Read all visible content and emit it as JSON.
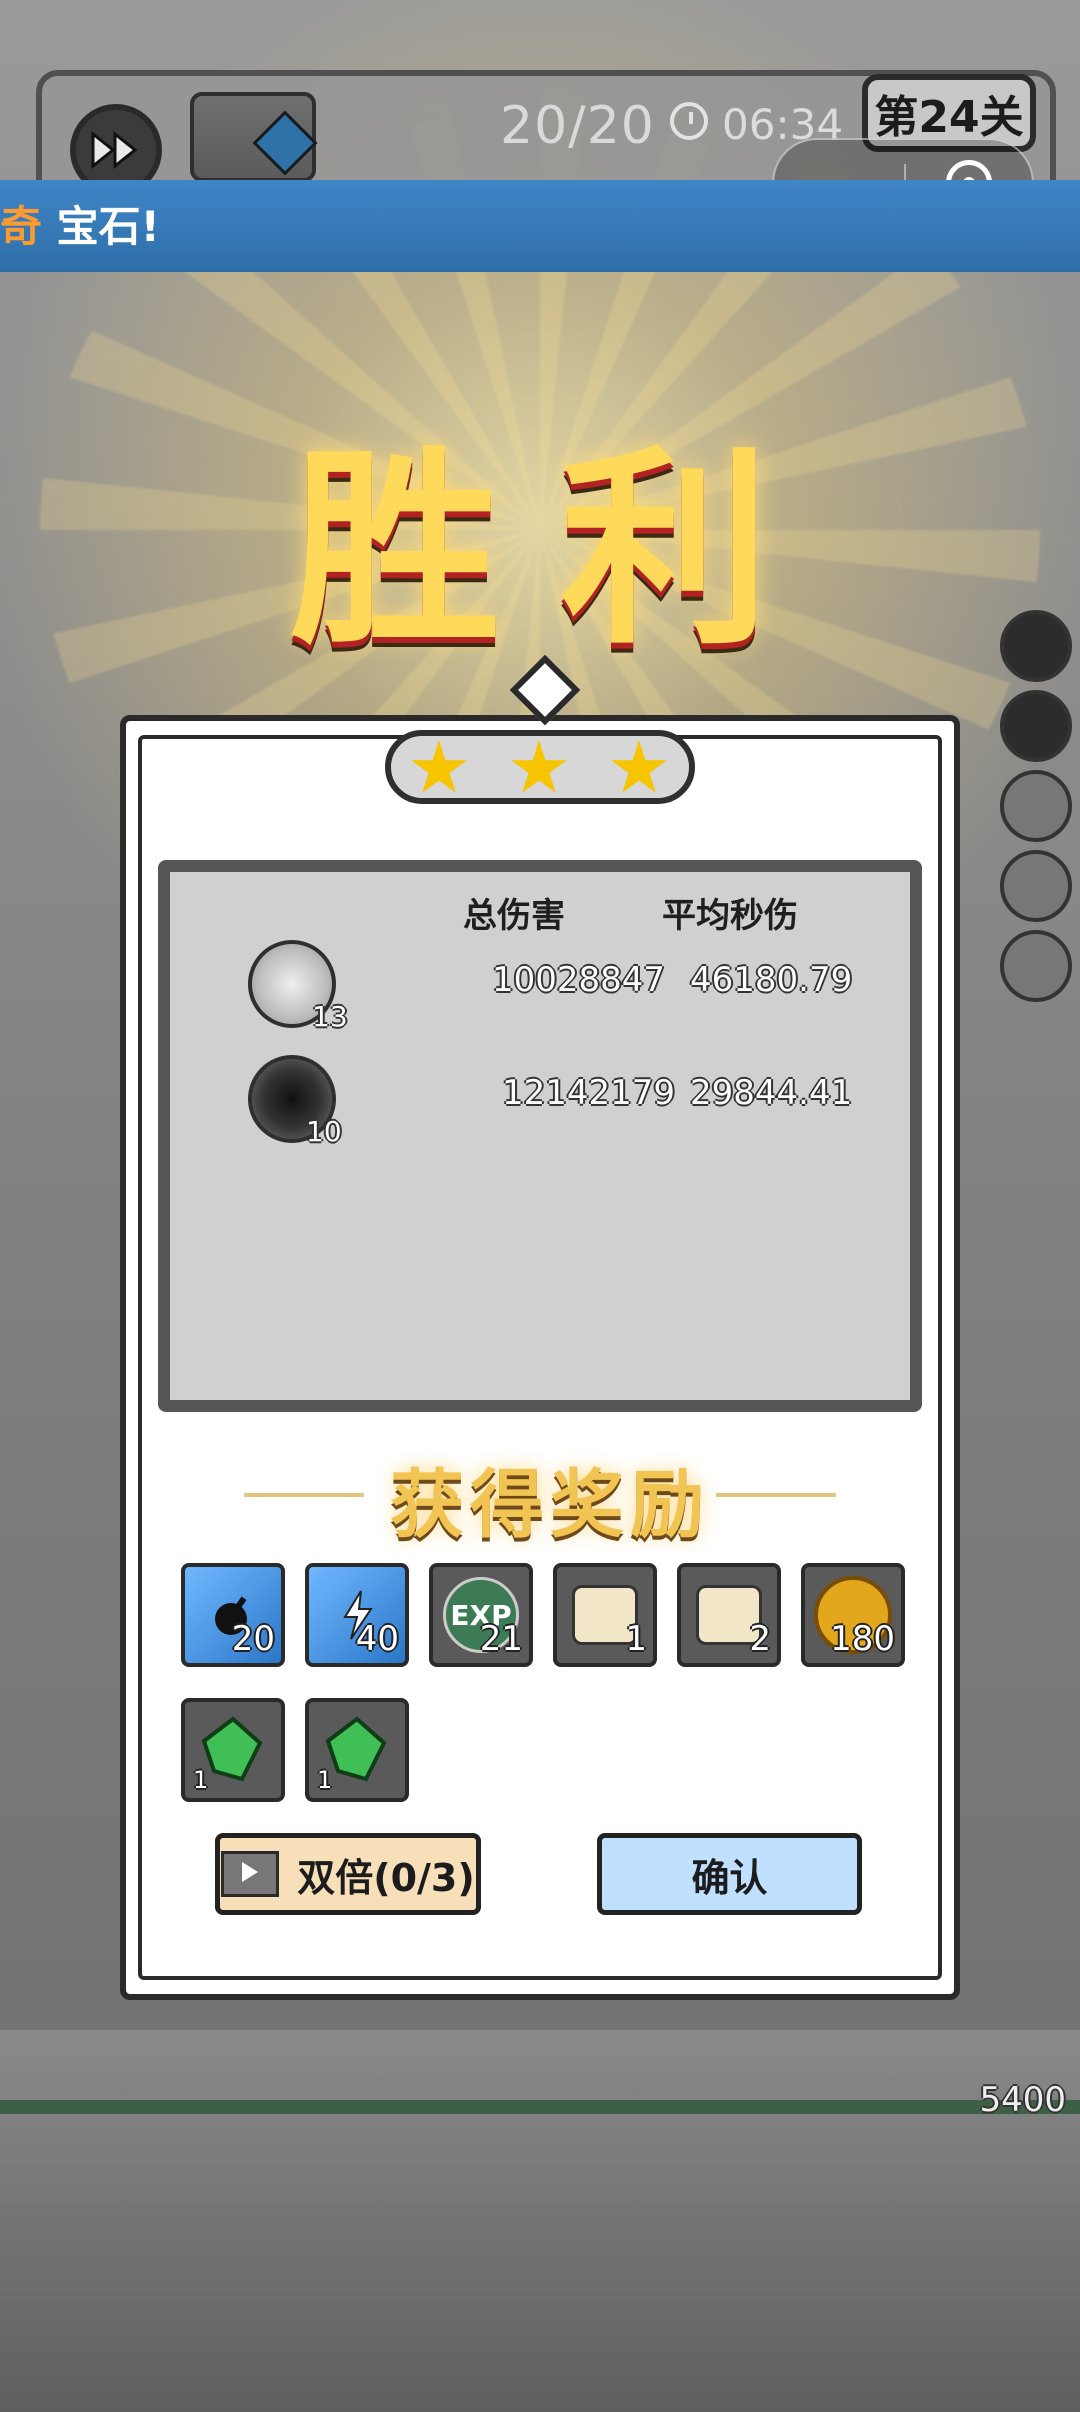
{
  "hud": {
    "progress": "20/20",
    "time": "06:34",
    "level": "第24关"
  },
  "banner": {
    "prefix": "奇",
    "text": "宝石!"
  },
  "victory": "胜利",
  "stars": 3,
  "stats": {
    "headers": [
      "总伤害",
      "平均秒伤"
    ],
    "rows": [
      {
        "skill_icon": "lightning-orb-icon",
        "level": "13",
        "total": "10028847",
        "avg": "46180.79"
      },
      {
        "skill_icon": "black-hole-icon",
        "level": "10",
        "total": "12142179",
        "avg": "29844.41"
      }
    ]
  },
  "rewards": {
    "title": "获得奖励",
    "items": [
      {
        "icon": "blue-gem-bomb-icon",
        "count": "20"
      },
      {
        "icon": "blue-gem-lightning-icon",
        "count": "40"
      },
      {
        "icon": "exp-orb-icon",
        "label": "EXP",
        "count": "21"
      },
      {
        "icon": "scroll-icon",
        "count": "1"
      },
      {
        "icon": "scroll-icon",
        "count": "2"
      },
      {
        "icon": "gold-coin-icon",
        "count": "180"
      },
      {
        "icon": "green-crystal-icon",
        "count": "1"
      },
      {
        "icon": "green-crystal-icon",
        "count": "1"
      }
    ]
  },
  "buttons": {
    "double": "双倍(0/3)",
    "confirm": "确认"
  },
  "bottom_number": "5400"
}
